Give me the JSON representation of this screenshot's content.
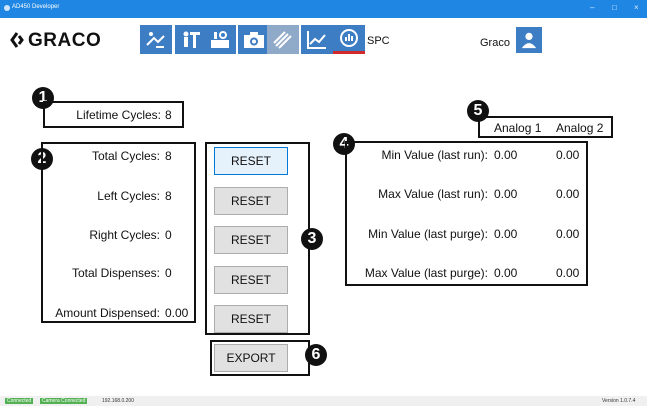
{
  "window": {
    "title": "AD450 Developer",
    "controls": [
      "–",
      "□",
      "×"
    ]
  },
  "header": {
    "logo_text": "GRACO",
    "nav_icons": [
      "spray-gun-icon",
      "operator-icon",
      "dispense-settings-icon",
      "camera-icon",
      "material-icon",
      "chart-icon",
      "spc-icon"
    ],
    "active_label": "SPC",
    "user_name": "Graco"
  },
  "badges": [
    "1",
    "2",
    "3",
    "4",
    "5",
    "6"
  ],
  "lifetime": {
    "label": "Lifetime Cycles:",
    "value": "8"
  },
  "counters": [
    {
      "label": "Total Cycles:",
      "value": "8"
    },
    {
      "label": "Left Cycles:",
      "value": "8"
    },
    {
      "label": "Right Cycles:",
      "value": "0"
    },
    {
      "label": "Total Dispenses:",
      "value": "0"
    },
    {
      "label": "Amount Dispensed:",
      "value": "0.00"
    }
  ],
  "reset_label": "RESET",
  "export_label": "EXPORT",
  "analog": {
    "headers": [
      "Analog 1",
      "Analog 2"
    ],
    "rows": [
      {
        "label": "Min Value (last run):",
        "a1": "0.00",
        "a2": "0.00"
      },
      {
        "label": "Max Value (last run):",
        "a1": "0.00",
        "a2": "0.00"
      },
      {
        "label": "Min Value (last purge):",
        "a1": "0.00",
        "a2": "0.00"
      },
      {
        "label": "Max Value (last purge):",
        "a1": "0.00",
        "a2": "0.00"
      }
    ]
  },
  "status": {
    "connected": "Connected",
    "camera": "Camera Connected",
    "ip": "192.168.0.200",
    "version": "Version 1.0.7.4"
  },
  "colors": {
    "titlebar": "#1f86e3",
    "nav": "#3d7dc4",
    "active_underline": "#d22a2a",
    "status_green": "#53b153"
  }
}
